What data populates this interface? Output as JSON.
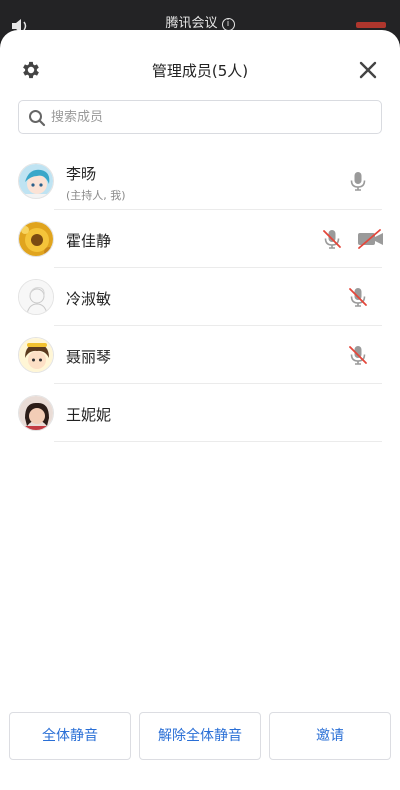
{
  "status_bar": {
    "meeting_title": "腾讯会议",
    "info_symbol": "i",
    "speaker_icon": "speaker-icon",
    "end_icon": "end-call-icon"
  },
  "header": {
    "title": "管理成员(5人)",
    "settings_icon": "gear-icon",
    "close_icon": "close-icon"
  },
  "search": {
    "placeholder": "搜索成员",
    "value": ""
  },
  "members": [
    {
      "name": "李旸",
      "subtitle": "(主持人, 我)",
      "mic": "on",
      "camera": "none",
      "avatar": "avatar-anime-girl"
    },
    {
      "name": "霍佳静",
      "subtitle": "",
      "mic": "muted",
      "camera": "off",
      "avatar": "avatar-sunflower"
    },
    {
      "name": "冷淑敏",
      "subtitle": "",
      "mic": "muted",
      "camera": "none",
      "avatar": "avatar-sketch"
    },
    {
      "name": "聂丽琴",
      "subtitle": "",
      "mic": "muted",
      "camera": "none",
      "avatar": "avatar-cartoon-girl"
    },
    {
      "name": "王妮妮",
      "subtitle": "",
      "mic": "none",
      "camera": "none",
      "avatar": "avatar-photo"
    }
  ],
  "footer": {
    "mute_all": "全体静音",
    "unmute_all": "解除全体静音",
    "invite": "邀请"
  },
  "colors": {
    "accent": "#2a6fd6",
    "muted_red": "#e4463a",
    "icon_gray": "#9a9a9a"
  }
}
